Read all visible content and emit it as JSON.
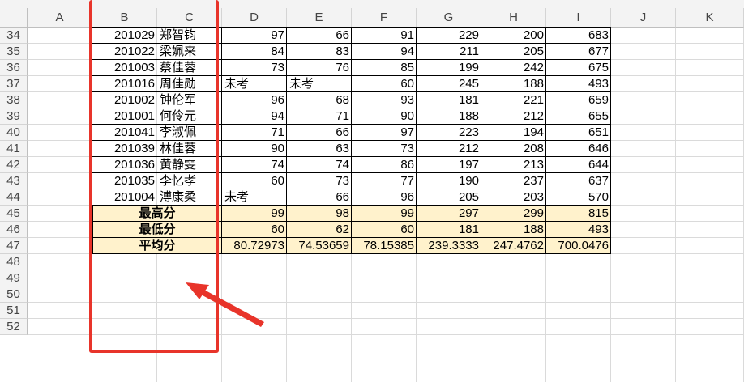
{
  "columns": [
    "A",
    "B",
    "C",
    "D",
    "E",
    "F",
    "G",
    "H",
    "I",
    "J",
    "K"
  ],
  "rows": [
    "34",
    "35",
    "36",
    "37",
    "38",
    "39",
    "40",
    "41",
    "42",
    "43",
    "44",
    "45",
    "46",
    "47",
    "48",
    "49",
    "50",
    "51",
    "52"
  ],
  "students": [
    {
      "id": "201029",
      "name": "郑智钧",
      "d": "97",
      "e": "66",
      "f": "91",
      "g": "229",
      "h": "200",
      "i": "683"
    },
    {
      "id": "201022",
      "name": "梁姵来",
      "d": "84",
      "e": "83",
      "f": "94",
      "g": "211",
      "h": "205",
      "i": "677"
    },
    {
      "id": "201003",
      "name": "蔡佳蓉",
      "d": "73",
      "e": "76",
      "f": "85",
      "g": "199",
      "h": "242",
      "i": "675"
    },
    {
      "id": "201016",
      "name": "周佳勋",
      "d": "未考",
      "e": "未考",
      "f": "60",
      "g": "245",
      "h": "188",
      "i": "493"
    },
    {
      "id": "201002",
      "name": "钟伦军",
      "d": "96",
      "e": "68",
      "f": "93",
      "g": "181",
      "h": "221",
      "i": "659"
    },
    {
      "id": "201001",
      "name": "何伶元",
      "d": "94",
      "e": "71",
      "f": "90",
      "g": "188",
      "h": "212",
      "i": "655"
    },
    {
      "id": "201041",
      "name": "李淑佩",
      "d": "71",
      "e": "66",
      "f": "97",
      "g": "223",
      "h": "194",
      "i": "651"
    },
    {
      "id": "201039",
      "name": "林佳蓉",
      "d": "90",
      "e": "63",
      "f": "73",
      "g": "212",
      "h": "208",
      "i": "646"
    },
    {
      "id": "201036",
      "name": "黄静雯",
      "d": "74",
      "e": "74",
      "f": "86",
      "g": "197",
      "h": "213",
      "i": "644"
    },
    {
      "id": "201035",
      "name": "李忆孝",
      "d": "60",
      "e": "73",
      "f": "77",
      "g": "190",
      "h": "237",
      "i": "637"
    },
    {
      "id": "201004",
      "name": "溥康柔",
      "d": "未考",
      "e": "66",
      "f": "96",
      "g": "205",
      "h": "203",
      "i": "570"
    }
  ],
  "summary": [
    {
      "label": "最高分",
      "d": "99",
      "e": "98",
      "f": "99",
      "g": "297",
      "h": "299",
      "i": "815"
    },
    {
      "label": "最低分",
      "d": "60",
      "e": "62",
      "f": "60",
      "g": "181",
      "h": "188",
      "i": "493"
    },
    {
      "label": "平均分",
      "d": "80.72973",
      "e": "74.53659",
      "f": "78.15385",
      "g": "239.3333",
      "h": "247.4762",
      "i": "700.0476"
    }
  ],
  "colors": {
    "summary_fill": "#fff2cc",
    "annotation": "#e8342a"
  }
}
